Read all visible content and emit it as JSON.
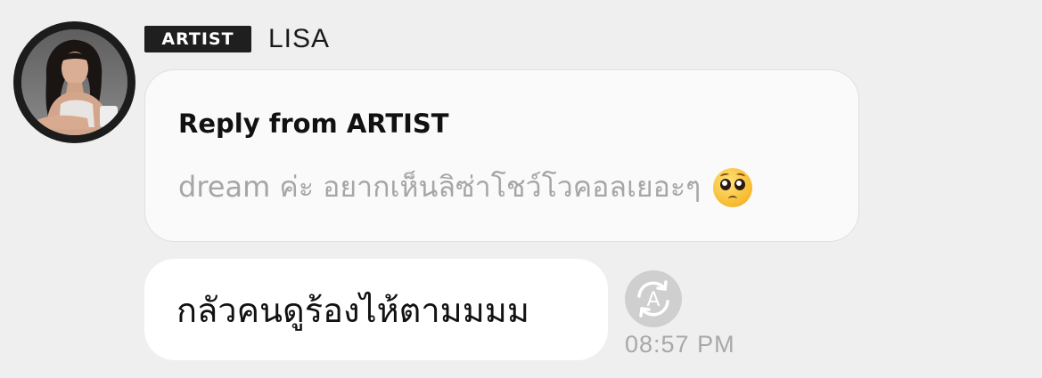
{
  "sender": {
    "badge": "ARTIST",
    "name": "LISA",
    "avatar": "profile-photo"
  },
  "reply": {
    "title": "Reply from ARTIST",
    "quoted_text": "dream ค่ะ อยากเห็นลิซ่าโชว์โวคอลเยอะๆ",
    "emoji": "pleading-face-emoji"
  },
  "message": {
    "text": "กลัวคนดูร้องไห้ตามมมม",
    "timestamp": "08:57 PM",
    "translate_icon": "auto-translate-icon"
  },
  "colors": {
    "background": "#efefef",
    "badge_bg": "#1f1f1f",
    "bubble_bg": "#ffffff",
    "muted_text": "#a6a6a6"
  }
}
